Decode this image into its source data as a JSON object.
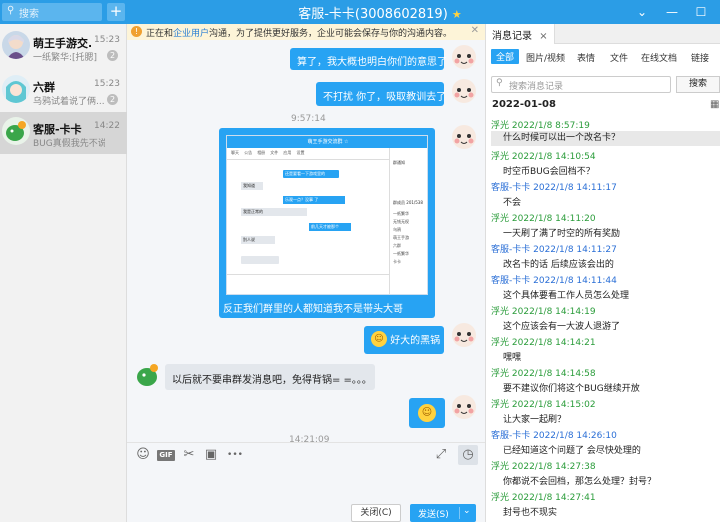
{
  "window": {
    "title": "客服-卡卡(3008602819)",
    "search_placeholder": "搜索",
    "add_label": "+",
    "controls": {
      "dropdown": "⌄",
      "minimize": "—",
      "maximize": "☐"
    }
  },
  "conversations": [
    {
      "name": "萌王手游交...",
      "time": "15:23",
      "preview": "一纸繁华:[托腮]",
      "badge": "2"
    },
    {
      "name": "六群",
      "time": "15:23",
      "preview": "乌鸦试着说了俩...",
      "badge": "2"
    },
    {
      "name": "客服-卡卡",
      "time": "14:22",
      "preview": "BUG真假我先不说，...",
      "badge": ""
    }
  ],
  "chat": {
    "notice": {
      "prefix": "正在和",
      "link": "企业用户",
      "suffix": "沟通，为了提供更好服务，企业可能会保存与你的沟通内容。"
    },
    "messages": {
      "m1": "算了，我大概也明白你们的意思了",
      "m2": "不打扰 你了，吸取教训去了",
      "t1": "9:57:14",
      "m3_caption": "反正我们群里的人都知道我不是带头大哥",
      "m4": "好大的黑锅",
      "m5": "以后就不要串群发消息吧，免得背锅= =。。。",
      "t2": "14:21:09"
    },
    "embedded_screenshot": {
      "title": "萌王手游交流群 ☆",
      "tabs": [
        "聊天",
        "公告",
        "相册",
        "文件",
        "应用",
        "设置"
      ],
      "bubbles": [
        "还是要看一下游戏里的",
        "我知道",
        "乐观一点？没事 了",
        "我是正常的",
        "前几天才被那个",
        "别人说"
      ],
      "side_title": "群通知",
      "side_heading": "群成员 201/538",
      "members": [
        "一纸繁华",
        "无钱无权",
        "乌鸦",
        "萌王手游",
        "六群",
        "一纸繁华",
        "卡卡"
      ]
    },
    "toolbar": {
      "emoji": "☺",
      "gif": "GIF",
      "cut": "✂",
      "image": "▣",
      "more": "•••",
      "expand": "⤢",
      "history": "◷"
    },
    "close_label": "关闭(C)",
    "send_label": "发送(S)",
    "send_arrow": "⌄"
  },
  "history": {
    "tab_label": "消息记录",
    "tab_close": "×",
    "filters": [
      "全部",
      "图片/视频",
      "表情",
      "文件",
      "在线文档",
      "链接"
    ],
    "search_placeholder": "搜索消息记录",
    "search_button": "搜索",
    "date": "2022-01-08",
    "colors": {
      "self": "#2a9c3a",
      "other": "#2b6fd6"
    },
    "records": [
      {
        "sender": "浮光",
        "time": "2022/1/8 8:57:19",
        "text": "什么时候可以出一个改名卡？",
        "who": "self",
        "hl": true
      },
      {
        "sender": "浮光",
        "time": "2022/1/8 14:10:54",
        "text": "时空币BUG会回档不？",
        "who": "self",
        "hl": false
      },
      {
        "sender": "客服-卡卡",
        "time": "2022/1/8 14:11:17",
        "text": "不会",
        "who": "other",
        "hl": false
      },
      {
        "sender": "浮光",
        "time": "2022/1/8 14:11:20",
        "text": "一天刷了满了时空的所有奖励",
        "who": "self",
        "hl": false
      },
      {
        "sender": "客服-卡卡",
        "time": "2022/1/8 14:11:27",
        "text": "改名卡的话 后续应该会出的",
        "who": "other",
        "hl": false
      },
      {
        "sender": "客服-卡卡",
        "time": "2022/1/8 14:11:44",
        "text": "这个具体要看工作人员怎么处理",
        "who": "other",
        "hl": false
      },
      {
        "sender": "浮光",
        "time": "2022/1/8 14:14:19",
        "text": "这个应该会有一大波人退游了",
        "who": "self",
        "hl": false
      },
      {
        "sender": "浮光",
        "time": "2022/1/8 14:14:21",
        "text": "嘿嘿",
        "who": "self",
        "hl": false
      },
      {
        "sender": "浮光",
        "time": "2022/1/8 14:14:58",
        "text": "要不建议你们将这个BUG继续开放",
        "who": "self",
        "hl": false
      },
      {
        "sender": "浮光",
        "time": "2022/1/8 14:15:02",
        "text": "让大家一起刷？",
        "who": "self",
        "hl": false
      },
      {
        "sender": "客服-卡卡",
        "time": "2022/1/8 14:26:10",
        "text": "已经知道这个问题了  会尽快处理的",
        "who": "other",
        "hl": false
      },
      {
        "sender": "浮光",
        "time": "2022/1/8 14:27:38",
        "text": "你都说不会回档，那怎么处理？封号？",
        "who": "self",
        "hl": false
      },
      {
        "sender": "浮光",
        "time": "2022/1/8 14:27:41",
        "text": "封号也不现实",
        "who": "self",
        "hl": false
      }
    ]
  }
}
